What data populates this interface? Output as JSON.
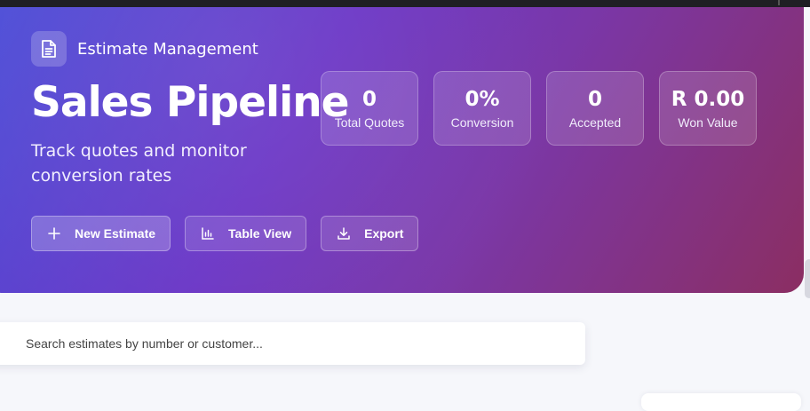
{
  "header": {
    "section_label": "Estimate Management",
    "section_icon": "document-icon",
    "title": "Sales Pipeline",
    "subtitle": "Track quotes and monitor conversion rates",
    "gradient_colors": [
      "#4c4fd8",
      "#6b36c6",
      "#7a37a8",
      "#8b2e62"
    ]
  },
  "stats": [
    {
      "value": "0",
      "label": "Total Quotes"
    },
    {
      "value": "0%",
      "label": "Conversion"
    },
    {
      "value": "0",
      "label": "Accepted"
    },
    {
      "value": "R 0.00",
      "label": "Won Value"
    }
  ],
  "actions": [
    {
      "label": "New Estimate",
      "icon": "plus-icon"
    },
    {
      "label": "Table View",
      "icon": "bar-chart-icon"
    },
    {
      "label": "Export",
      "icon": "download-icon"
    }
  ],
  "search": {
    "placeholder": "Search estimates by number or customer...",
    "value": ""
  }
}
